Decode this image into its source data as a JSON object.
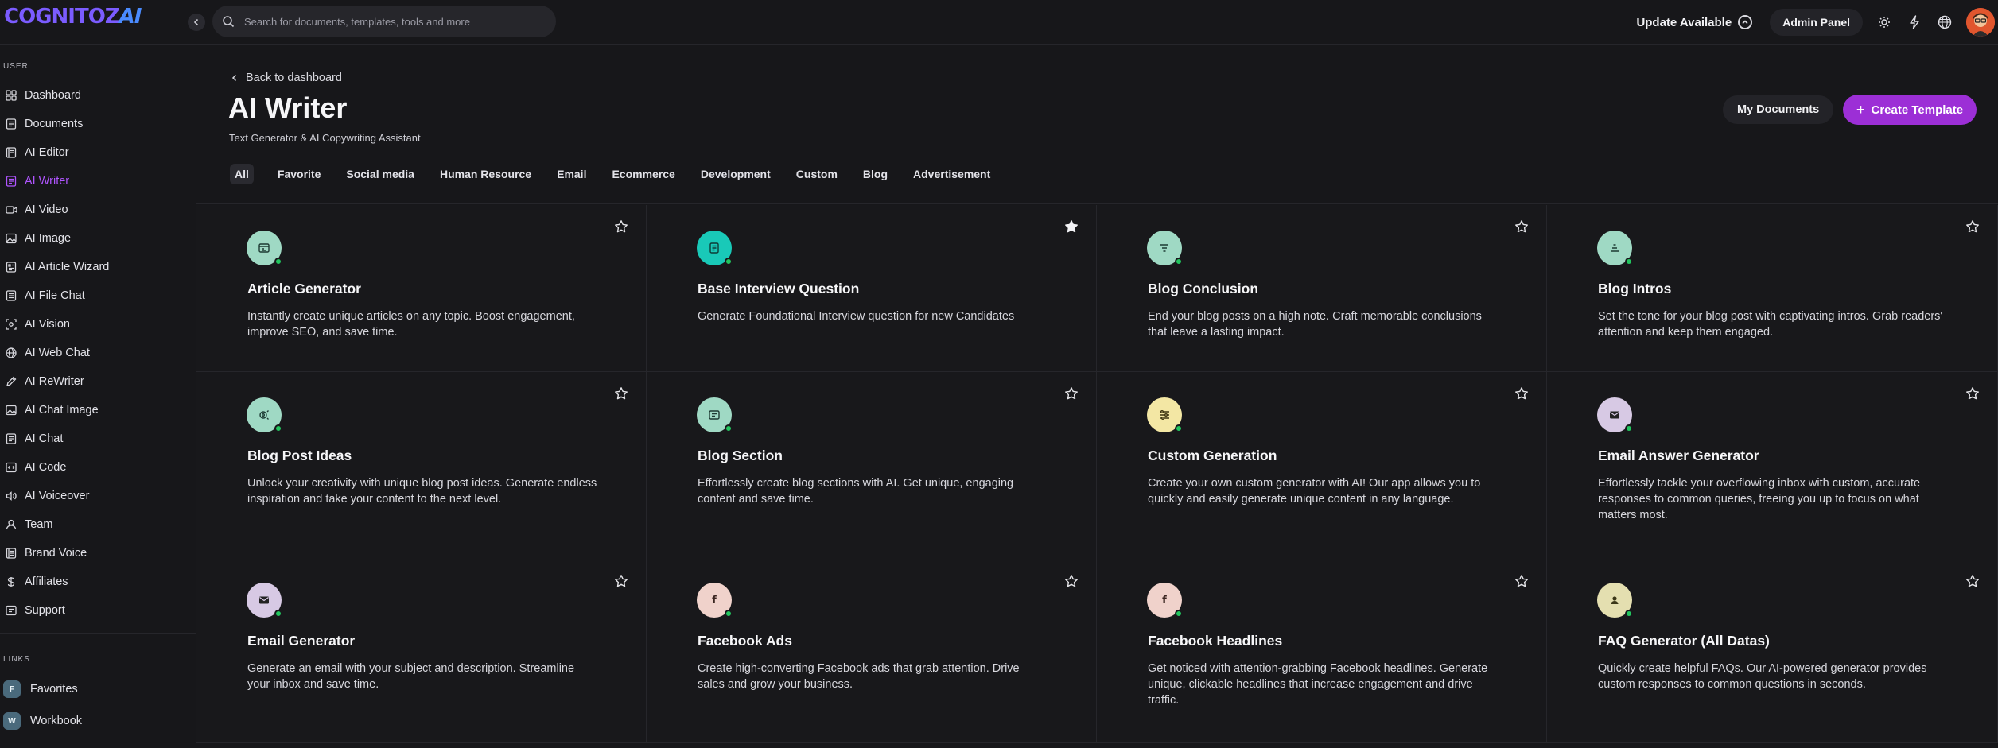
{
  "app": {
    "logo_main": "COGNITOZ",
    "logo_ai": "AI"
  },
  "topbar": {
    "search_placeholder": "Search for documents, templates, tools and more",
    "update_label": "Update Available",
    "admin_label": "Admin Panel"
  },
  "sidebar": {
    "user_section": "USER",
    "items": [
      {
        "label": "Dashboard",
        "icon": "dashboard-icon"
      },
      {
        "label": "Documents",
        "icon": "documents-icon"
      },
      {
        "label": "AI Editor",
        "icon": "editor-icon"
      },
      {
        "label": "AI Writer",
        "icon": "writer-icon",
        "active": true
      },
      {
        "label": "AI Video",
        "icon": "video-icon"
      },
      {
        "label": "AI Image",
        "icon": "image-icon"
      },
      {
        "label": "AI Article Wizard",
        "icon": "article-wizard-icon"
      },
      {
        "label": "AI File Chat",
        "icon": "file-chat-icon"
      },
      {
        "label": "AI Vision",
        "icon": "vision-icon"
      },
      {
        "label": "AI Web Chat",
        "icon": "web-chat-icon"
      },
      {
        "label": "AI ReWriter",
        "icon": "rewriter-icon"
      },
      {
        "label": "AI Chat Image",
        "icon": "chat-image-icon"
      },
      {
        "label": "AI Chat",
        "icon": "chat-icon"
      },
      {
        "label": "AI Code",
        "icon": "code-icon"
      },
      {
        "label": "AI Voiceover",
        "icon": "voiceover-icon"
      },
      {
        "label": "Team",
        "icon": "team-icon"
      },
      {
        "label": "Brand Voice",
        "icon": "brand-voice-icon"
      },
      {
        "label": "Affiliates",
        "icon": "dollar-icon"
      },
      {
        "label": "Support",
        "icon": "support-icon"
      }
    ],
    "links_section": "LINKS",
    "links": [
      {
        "badge": "F",
        "label": "Favorites"
      },
      {
        "badge": "W",
        "label": "Workbook"
      }
    ]
  },
  "main": {
    "back_label": "Back to dashboard",
    "title": "AI Writer",
    "subtitle": "Text Generator & AI Copywriting Assistant",
    "my_documents": "My Documents",
    "create_template": "Create Template",
    "tabs": [
      "All",
      "Favorite",
      "Social media",
      "Human Resource",
      "Email",
      "Ecommerce",
      "Development",
      "Custom",
      "Blog",
      "Advertisement"
    ],
    "active_tab": "All"
  },
  "cards": [
    {
      "title": "Article Generator",
      "desc": "Instantly create unique articles on any topic. Boost engagement, improve SEO, and save time.",
      "icon": "article-icon",
      "icon_bg": "#9fd9c4",
      "favorite": false
    },
    {
      "title": "Base Interview Question",
      "desc": "Generate Foundational Interview question for new Candidates",
      "icon": "document-icon",
      "icon_bg": "#19c9b8",
      "favorite": true
    },
    {
      "title": "Blog Conclusion",
      "desc": "End your blog posts on a high note. Craft memorable conclusions that leave a lasting impact.",
      "icon": "align-center-icon",
      "icon_bg": "#9fd9c4",
      "favorite": false
    },
    {
      "title": "Blog Intros",
      "desc": "Set the tone for your blog post with captivating intros. Grab readers' attention and keep them engaged.",
      "icon": "align-center-icon",
      "icon_bg": "#9fd9c4",
      "favorite": false
    },
    {
      "title": "Blog Post Ideas",
      "desc": "Unlock your creativity with unique blog post ideas. Generate endless inspiration and take your content to the next level.",
      "icon": "idea-icon",
      "icon_bg": "#9fd9c4",
      "favorite": false
    },
    {
      "title": "Blog Section",
      "desc": "Effortlessly create blog sections with AI. Get unique, engaging content and save time.",
      "icon": "section-icon",
      "icon_bg": "#9fd9c4",
      "favorite": false
    },
    {
      "title": "Custom Generation",
      "desc": "Create your own custom generator with AI! Our app allows you to quickly and easily generate unique content in any language.",
      "icon": "sliders-icon",
      "icon_bg": "#f3e7a4",
      "favorite": false
    },
    {
      "title": "Email Answer Generator",
      "desc": "Effortlessly tackle your overflowing inbox with custom, accurate responses to common queries, freeing you up to focus on what matters most.",
      "icon": "mail-icon",
      "icon_bg": "#d7c9e4",
      "favorite": false
    },
    {
      "title": "Email Generator",
      "desc": "Generate an email with your subject and description. Streamline your inbox and save time.",
      "icon": "mail-icon",
      "icon_bg": "#d7c9e4",
      "favorite": false
    },
    {
      "title": "Facebook Ads",
      "desc": "Create high-converting Facebook ads that grab attention. Drive sales and grow your business.",
      "icon": "facebook-icon",
      "icon_bg": "#f0d2cb",
      "favorite": false
    },
    {
      "title": "Facebook Headlines",
      "desc": "Get noticed with attention-grabbing Facebook headlines. Generate unique, clickable headlines that increase engagement and drive traffic.",
      "icon": "facebook-icon",
      "icon_bg": "#f0d2cb",
      "favorite": false
    },
    {
      "title": "FAQ Generator (All Datas)",
      "desc": "Quickly create helpful FAQs. Our AI-powered generator provides custom responses to common questions in seconds.",
      "icon": "person-icon",
      "icon_bg": "#e4dfb0",
      "favorite": false
    }
  ],
  "colors": {
    "accent": "#9c2fd6",
    "active_nav": "#b055ff",
    "status_dot": "#22c55e",
    "background": "#17171a"
  }
}
